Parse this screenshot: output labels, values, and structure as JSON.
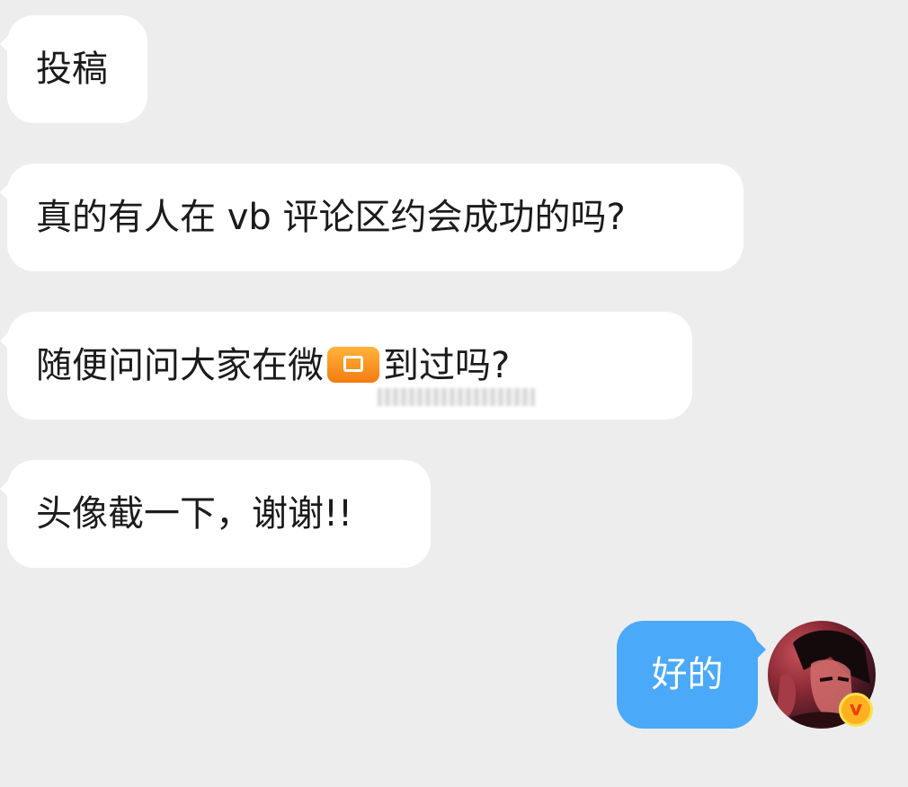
{
  "messages": [
    {
      "text": "投稿"
    },
    {
      "text": "真的有人在 vb 评论区约会成功的吗?"
    },
    {
      "text_before": "随便问问大家在微",
      "text_after": "到过吗?"
    },
    {
      "text": "头像截一下，谢谢!!"
    }
  ],
  "reply": {
    "text": "好的"
  },
  "avatar": {
    "badge": "v",
    "badge_icon": "vip-badge-icon"
  },
  "colors": {
    "background": "#ededed",
    "incoming_bubble": "#ffffff",
    "outgoing_bubble": "#4aa9f8",
    "badge": "#ffb020"
  }
}
